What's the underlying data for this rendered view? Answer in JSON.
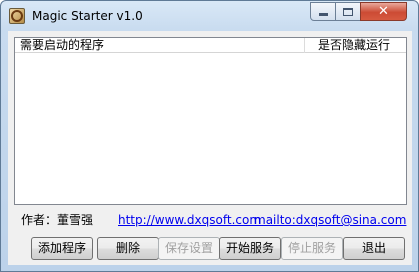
{
  "window": {
    "title": "Magic Starter v1.0",
    "close_glyph": "✕"
  },
  "list": {
    "columns": [
      "需要启动的程序",
      "是否隐藏运行"
    ],
    "rows": []
  },
  "info": {
    "author": "作者：董雪强",
    "website": "http://www.dxqsoft.com",
    "email": "mailto:dxqsoft@sina.com"
  },
  "buttons": {
    "add": "添加程序",
    "delete": "删除",
    "save": "保存设置",
    "start_service": "开始服务",
    "stop_service": "停止服务",
    "exit": "退出"
  }
}
